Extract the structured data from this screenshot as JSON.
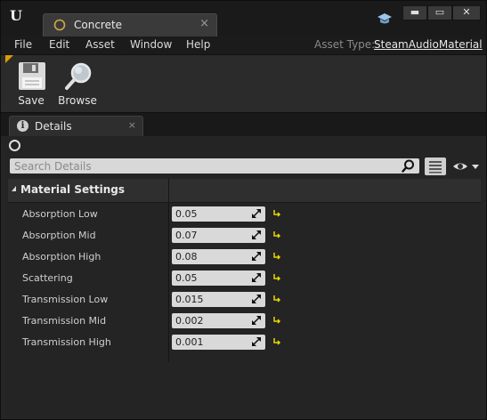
{
  "window": {
    "tab_title": "Concrete",
    "tab_close": "×",
    "min_label": "▬",
    "max_label": "▭",
    "close_label": "✕"
  },
  "menu": {
    "items": [
      "File",
      "Edit",
      "Asset",
      "Window",
      "Help"
    ],
    "asset_type_label": "Asset Type:",
    "asset_type_value": "SteamAudioMaterial"
  },
  "toolbar": {
    "save_label": "Save",
    "browse_label": "Browse"
  },
  "details": {
    "tab_label": "Details",
    "tab_close": "×",
    "search_placeholder": "Search Details",
    "category_label": "Material Settings",
    "properties": [
      {
        "label": "Absorption Low",
        "value": "0.05"
      },
      {
        "label": "Absorption Mid",
        "value": "0.07"
      },
      {
        "label": "Absorption High",
        "value": "0.08"
      },
      {
        "label": "Scattering",
        "value": "0.05"
      },
      {
        "label": "Transmission Low",
        "value": "0.015"
      },
      {
        "label": "Transmission Mid",
        "value": "0.002"
      },
      {
        "label": "Transmission High",
        "value": "0.001"
      }
    ]
  },
  "icons": {
    "logo": "unreal-logo-icon",
    "tab": "material-sphere-icon",
    "graduate": "graduation-cap-icon",
    "save": "floppy-disk-icon",
    "browse": "magnifier-icon",
    "info": "info-icon",
    "search": "search-icon",
    "reset": "reset-arrow-icon"
  },
  "colors": {
    "accent": "#d6a000",
    "reset_icon": "#e6d800"
  }
}
